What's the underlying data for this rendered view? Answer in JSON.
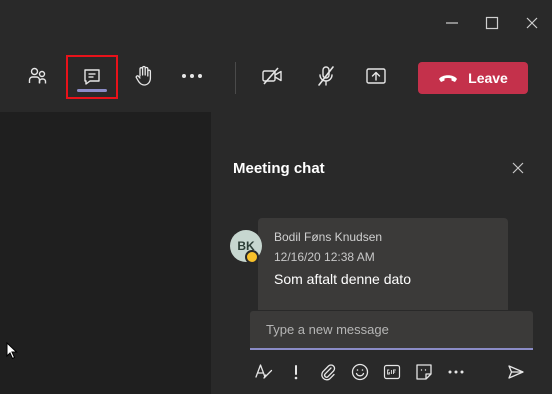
{
  "colors": {
    "accent": "#8b8cc7",
    "leave": "#c4314b",
    "highlight": "#e8121a",
    "presence_away": "#f8c12a"
  },
  "icons": {
    "titlebar": [
      "minimize-icon",
      "maximize-icon",
      "close-icon"
    ],
    "toolbar": [
      "people-icon",
      "chat-icon",
      "raise-hand-icon",
      "more-icon",
      "camera-off-icon",
      "mic-off-icon",
      "share-screen-icon",
      "phone-hangup-icon"
    ],
    "compose": [
      "format-icon",
      "important-icon",
      "attach-icon",
      "emoji-icon",
      "gif-icon",
      "sticker-icon",
      "more-icon",
      "send-icon"
    ]
  },
  "toolbar": {
    "leave_label": "Leave"
  },
  "chat": {
    "title": "Meeting chat",
    "messages": [
      {
        "avatar_initials": "BK",
        "sender": "Bodil Føns Knudsen",
        "time": "12/16/20 12:38 AM",
        "text": "Som aftalt denne dato"
      }
    ],
    "compose_placeholder": "Type a new message"
  }
}
